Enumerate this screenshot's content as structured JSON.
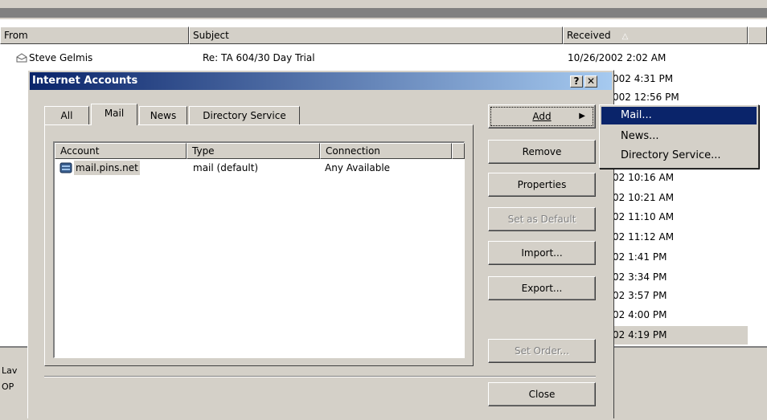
{
  "columns": {
    "from": "From",
    "subject": "Subject",
    "received": "Received",
    "sort_glyph": "△"
  },
  "messages": [
    {
      "from": "Steve Gelmis",
      "subject": "Re: TA 604/30 Day Trial",
      "received": "10/26/2002 2:02 AM"
    },
    {
      "received": "002 4:31 PM"
    },
    {
      "received": "002 12:56 PM"
    },
    {
      "received": "02 10:16 AM"
    },
    {
      "received": "02 10:21 AM"
    },
    {
      "received": "02 11:10 AM"
    },
    {
      "received": "02 11:12 AM"
    },
    {
      "received": "02 1:41 PM"
    },
    {
      "received": "02 3:34 PM"
    },
    {
      "received": "02 3:57 PM"
    },
    {
      "received": "02 4:00 PM"
    },
    {
      "received": "02 4:19 PM"
    }
  ],
  "status": {
    "line1": "Lav",
    "line2": "OP"
  },
  "dialog": {
    "title": "Internet Accounts",
    "help_glyph": "?",
    "close_glyph": "✕",
    "tabs": [
      "All",
      "Mail",
      "News",
      "Directory Service"
    ],
    "list_headers": [
      "Account",
      "Type",
      "Connection"
    ],
    "accounts": [
      {
        "account": "mail.pins.net",
        "type": "mail (default)",
        "connection": "Any Available"
      }
    ],
    "buttons": {
      "add": "Add",
      "remove": "Remove",
      "properties": "Properties",
      "set_default": "Set as Default",
      "import": "Import...",
      "export": "Export...",
      "set_order": "Set Order...",
      "close": "Close"
    }
  },
  "add_menu": [
    "Mail...",
    "News...",
    "Directory Service..."
  ]
}
